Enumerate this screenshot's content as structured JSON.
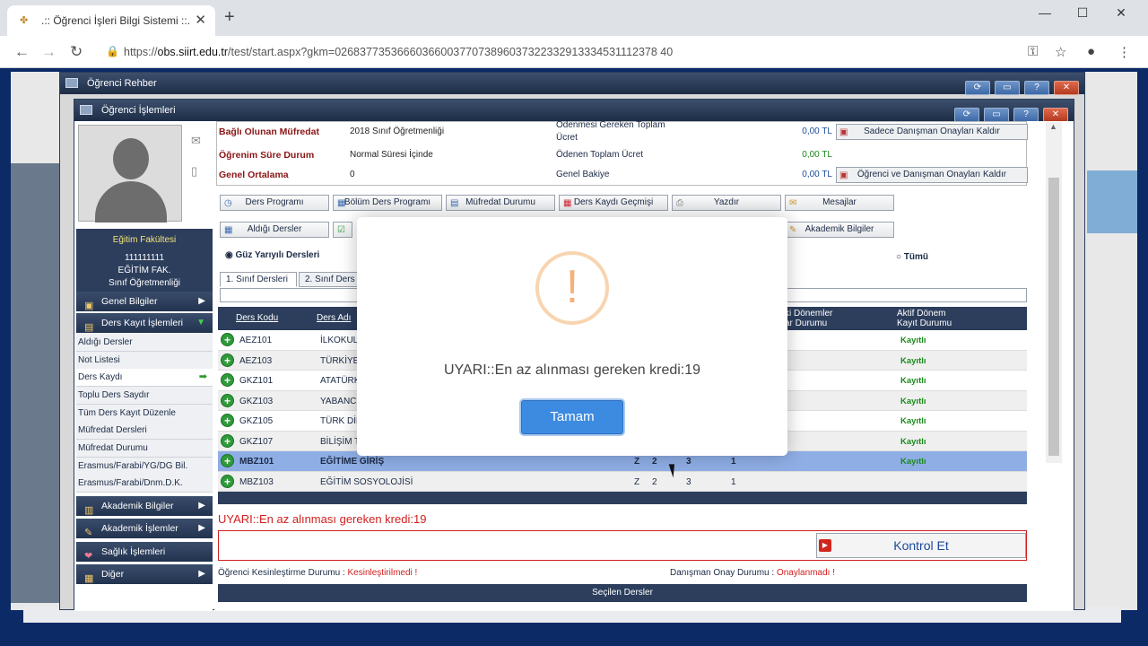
{
  "browser": {
    "tab_title": ".:: Öğrenci İşleri Bilgi Sistemi ::.",
    "url_host": "obs.siirt.edu.tr",
    "url_path": "/test/start.aspx?gkm=0268377353666036600377073896037322332913334531112378 40"
  },
  "window1": {
    "title": "Öğrenci Rehber"
  },
  "window2": {
    "title": "Öğrenci İşlemleri"
  },
  "student": {
    "faculty_title": "Eğitim Fakültesi",
    "number": "111111111",
    "faculty_short": "EĞİTİM FAK.",
    "program": "Sınıf Öğretmenliği"
  },
  "sidebar": {
    "genel_bilgiler": "Genel Bilgiler",
    "ders_kayit_islemleri": "Ders Kayıt İşlemleri",
    "subitems": [
      "Aldığı Dersler",
      "Not Listesi",
      "Ders Kaydı",
      "Toplu Ders Saydır",
      "Tüm Ders Kayıt Düzenle",
      "Müfredat Dersleri",
      "Müfredat Durumu",
      "Erasmus/Farabi/YG/DG Bil.",
      "Erasmus/Farabi/Dnm.D.K."
    ],
    "akademik_bilgiler": "Akademik Bilgiler",
    "akademik_islemler": "Akademik İşlemler",
    "saglik_islemleri": "Sağlık İşlemleri",
    "diger": "Diğer"
  },
  "summary": {
    "row1": {
      "label": "Bağlı Olunan Müfredat",
      "value": "2018 Sınıf Öğretmenliği",
      "label2a": "Ödenmesi Gereken Toplam",
      "label2b": "Ücret",
      "amount": "0,00 TL"
    },
    "row2": {
      "label": "Öğrenim Süre Durum",
      "value": "Normal Süresi İçinde",
      "label2": "Ödenen Toplam Ücret",
      "amount": "0,00 TL"
    },
    "row3": {
      "label": "Genel Ortalama",
      "value": "0",
      "label2": "Genel Bakiye",
      "amount": "0,00 TL"
    },
    "btn1": "Sadece Danışman Onayları Kaldır",
    "btn2": "Öğrenci ve Danışman Onayları Kaldır"
  },
  "actions": {
    "ders_programi": "Ders Programı",
    "bolum_ders_programi": "Bölüm Ders Programı",
    "mufredat_durumu": "Müfredat Durumu",
    "ders_kaydi_gecmisi": "Ders Kaydı Geçmişi",
    "yazdir": "Yazdır",
    "mesajlar": "Mesajlar",
    "aldigi_dersler": "Aldığı Dersler",
    "akademik_bilgiler": "Akademik Bilgiler"
  },
  "filters": {
    "guz": "Güz Yarıyılı Dersleri",
    "tumu": "Tümü",
    "tab1": "1. Sınıf Dersleri",
    "tab2": "2. Sınıf Ders"
  },
  "grid": {
    "col_code": "Ders Kodu",
    "col_name": "Ders Adı",
    "col_prev_a": "ki Dönemler",
    "col_prev_b": "ar Durumu",
    "col_active_a": "Aktif Dönem",
    "col_active_b": "Kayıt Durumu",
    "rows": [
      {
        "code": "AEZ101",
        "name": "İLKOKUL",
        "c1": "",
        "c2": "",
        "c3": "",
        "c4": "",
        "status": "Kayıtlı"
      },
      {
        "code": "AEZ103",
        "name": "TÜRKİYE",
        "c1": "",
        "c2": "",
        "c3": "",
        "c4": "",
        "status": "Kayıtlı"
      },
      {
        "code": "GKZ101",
        "name": "ATATÜRK",
        "c1": "",
        "c2": "",
        "c3": "",
        "c4": "",
        "status": "Kayıtlı"
      },
      {
        "code": "GKZ103",
        "name": "YABANCI",
        "c1": "",
        "c2": "",
        "c3": "",
        "c4": "",
        "status": "Kayıtlı"
      },
      {
        "code": "GKZ105",
        "name": "TÜRK DİL",
        "c1": "",
        "c2": "",
        "c3": "",
        "c4": "",
        "status": "Kayıtlı"
      },
      {
        "code": "GKZ107",
        "name": "BİLİŞİM T",
        "c1": "",
        "c2": "",
        "c3": "",
        "c4": "",
        "status": "Kayıtlı"
      },
      {
        "code": "MBZ101",
        "name": "EĞİTİME GİRİŞ",
        "c1": "Z",
        "c2": "2",
        "c3": "3",
        "c4": "1",
        "status": "Kayıtlı"
      },
      {
        "code": "MBZ103",
        "name": "EĞİTİM SOSYOLOJİSİ",
        "c1": "Z",
        "c2": "2",
        "c3": "3",
        "c4": "1",
        "status": ""
      }
    ]
  },
  "bottom": {
    "warning": "UYARI::En az alınması gereken kredi:19",
    "kontrol_et": "Kontrol Et",
    "kesinlestirme_label": "Öğrenci Kesinleştirme Durumu : ",
    "kesinlestirme_value": "Kesinleştirilmedi !",
    "danisman_label": "Danışman Onay Durumu : ",
    "danisman_value": "Onaylanmadı !",
    "secilen_dersler": "Seçilen Dersler"
  },
  "modal": {
    "icon": "!",
    "message": "UYARI::En az alınması gereken kredi:19",
    "button": "Tamam"
  },
  "colors": {
    "modal_button": "#3d8be0",
    "warning_icon": "#f5b17a",
    "header_navy": "#2c3e5c",
    "error_red": "#d21e1e",
    "status_green": "#1b8a1b"
  }
}
